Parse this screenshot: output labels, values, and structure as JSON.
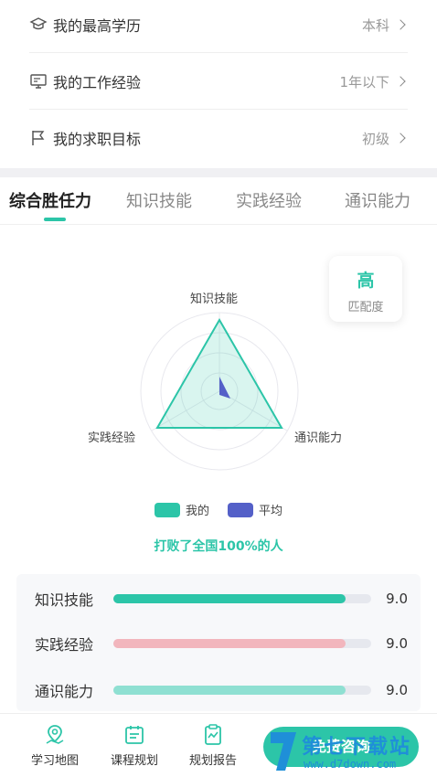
{
  "profile": {
    "rows": [
      {
        "label": "我的最高学历",
        "value": "本科",
        "icon": "graduation-cap-icon"
      },
      {
        "label": "我的工作经验",
        "value": "1年以下",
        "icon": "monitor-icon"
      },
      {
        "label": "我的求职目标",
        "value": "初级",
        "icon": "flag-icon"
      }
    ]
  },
  "tabs": [
    {
      "label": "综合胜任力",
      "active": true
    },
    {
      "label": "知识技能",
      "active": false
    },
    {
      "label": "实践经验",
      "active": false
    },
    {
      "label": "通识能力",
      "active": false
    }
  ],
  "match": {
    "level": "高",
    "label": "匹配度"
  },
  "radar": {
    "axes": [
      "知识技能",
      "通识能力",
      "实践经验"
    ],
    "mine_color": "#2cc5a8",
    "avg_color": "#5460c8"
  },
  "legend": {
    "mine": "我的",
    "avg": "平均"
  },
  "beat_text": "打败了全国100%的人",
  "scores": [
    {
      "label": "知识技能",
      "value": "9.0",
      "fraction": 0.9,
      "color": "#2cc5a8"
    },
    {
      "label": "实践经验",
      "value": "9.0",
      "fraction": 0.9,
      "color": "#f2b6bd"
    },
    {
      "label": "通识能力",
      "value": "9.0",
      "fraction": 0.9,
      "color": "#8fe0d2"
    }
  ],
  "bottom_nav": {
    "items": [
      {
        "label": "学习地图",
        "icon": "map-pin-icon"
      },
      {
        "label": "课程规划",
        "icon": "calendar-icon"
      },
      {
        "label": "规划报告",
        "icon": "clipboard-chart-icon"
      }
    ],
    "cta_label": "免费咨询"
  },
  "watermark": {
    "text": "第七下载站",
    "url": "www.d7down.com"
  }
}
